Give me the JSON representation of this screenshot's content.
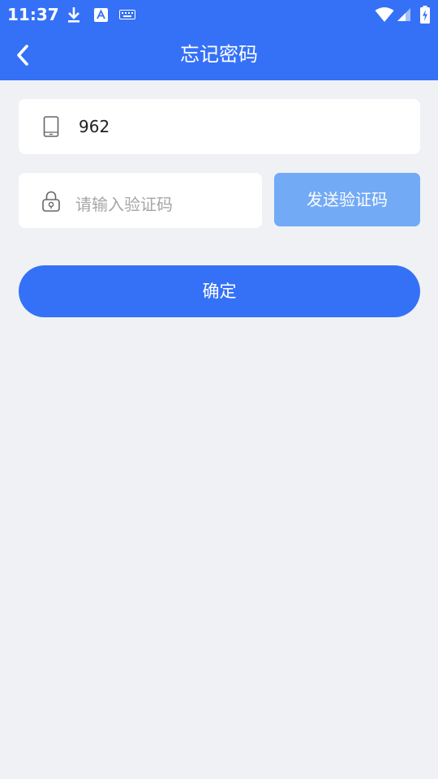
{
  "status_bar": {
    "time": "11:37",
    "icons": [
      "download-icon",
      "text-a-icon",
      "keyboard-icon",
      "wifi-icon",
      "cell-signal-icon",
      "battery-charging-icon"
    ]
  },
  "header": {
    "back_icon": "chevron-left-icon",
    "title": "忘记密码"
  },
  "form": {
    "phone": {
      "icon": "phone-icon",
      "value": "962"
    },
    "code": {
      "icon": "lock-icon",
      "placeholder": "请输入验证码",
      "value": ""
    },
    "send_code_label": "发送验证码",
    "confirm_label": "确定"
  },
  "colors": {
    "primary": "#3571f7",
    "send_button": "#73aaf6",
    "background": "#f0f1f5"
  }
}
